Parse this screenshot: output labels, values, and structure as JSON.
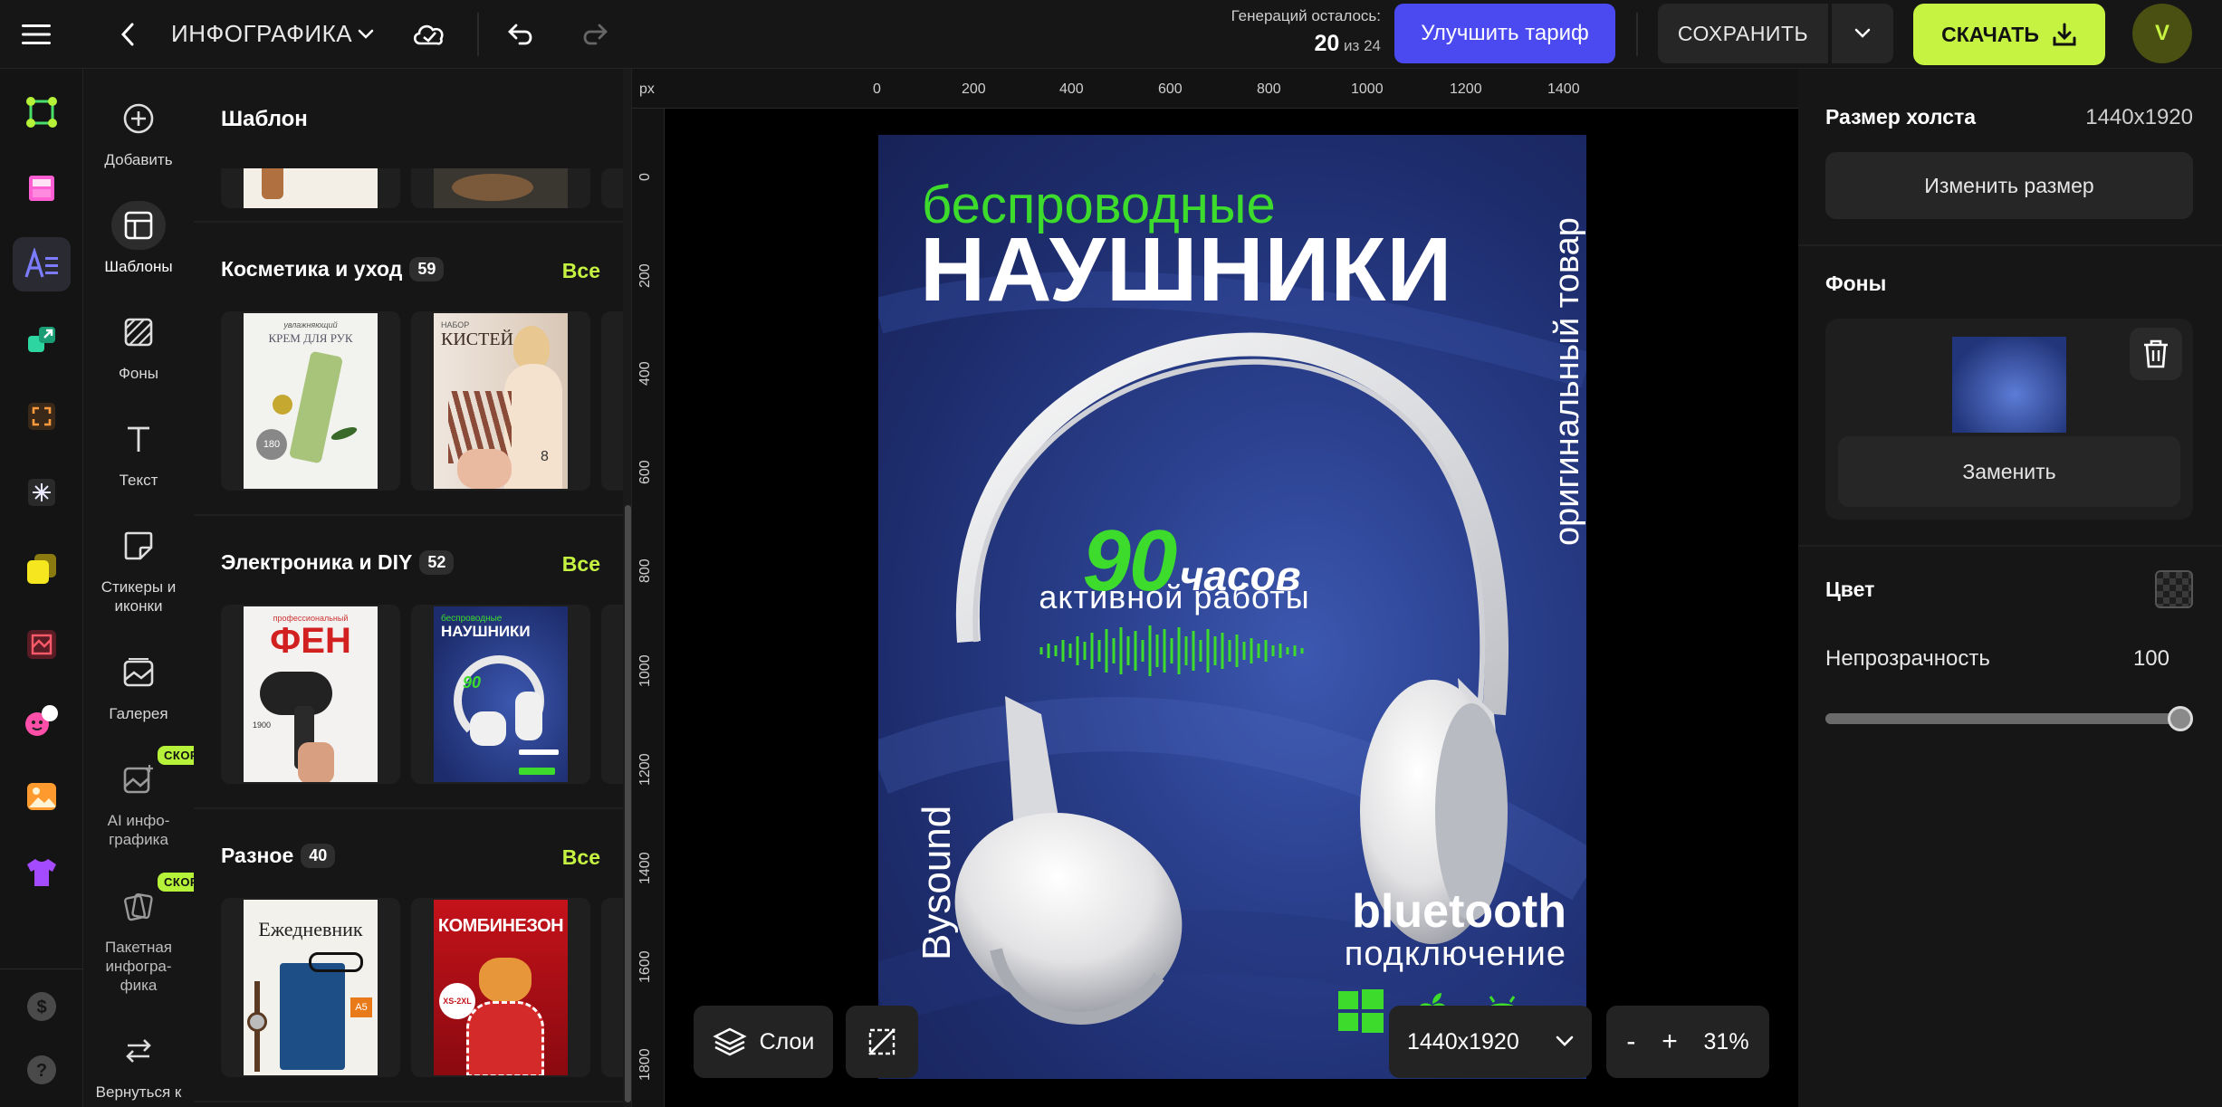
{
  "header": {
    "project_title": "ИНФОГРАФИКА",
    "generations_label": "Генераций осталось:",
    "generations_used": "20",
    "generations_sep": "из",
    "generations_total": "24",
    "upgrade_label": "Улучшить тариф",
    "save_label": "СОХРАНИТЬ",
    "download_label": "СКАЧАТЬ",
    "avatar_letter": "V",
    "accent_color": "#c6f242",
    "upgrade_color": "#4a4af0"
  },
  "rail": {
    "icons": [
      "nodes-icon",
      "layout-icon",
      "text-ai-icon",
      "resize-icon",
      "expand-icon",
      "sparkle-icon",
      "cards-icon",
      "collage-icon",
      "stickers-icon",
      "image-icon",
      "tshirt-icon"
    ],
    "bottom_icons": [
      "dollar-icon",
      "help-icon"
    ]
  },
  "tools": [
    {
      "label": "Добавить"
    },
    {
      "label": "Шаблоны"
    },
    {
      "label": "Фоны"
    },
    {
      "label": "Текст"
    },
    {
      "label": "Стикеры и иконки"
    },
    {
      "label": "Галерея"
    },
    {
      "label": "AI инфо-графика",
      "badge": "СКОРО"
    },
    {
      "label": "Пакетная инфогра-фика",
      "badge": "СКОРО"
    },
    {
      "label": "Вернуться к"
    }
  ],
  "panel": {
    "title": "Шаблон",
    "sections": [
      {
        "title": "Косметика и уход",
        "count": "59",
        "all": "Все",
        "thumbs": [
          {
            "top": "увлажняющий",
            "main": "КРЕМ ДЛЯ РУК",
            "num": "180"
          },
          {
            "top": "НАБОР",
            "main": "КИСТЕЙ",
            "num": "8"
          }
        ]
      },
      {
        "title": "Электроника и DIY",
        "count": "52",
        "all": "Все",
        "thumbs": [
          {
            "top": "профессиональный",
            "main": "ФЕН",
            "num": "1900"
          },
          {
            "top": "беспроводные",
            "main": "НАУШНИКИ",
            "num": "90"
          }
        ]
      },
      {
        "title": "Разное",
        "count": "40",
        "all": "Все",
        "thumbs": [
          {
            "top": "",
            "main": "Ежедневник",
            "num": "A5"
          },
          {
            "top": "",
            "main": "КОМБИНЕЗОН",
            "num": "XS-2XL"
          }
        ]
      }
    ]
  },
  "rulers": {
    "unit": "px",
    "top": [
      "0",
      "200",
      "400",
      "600",
      "800",
      "1000",
      "1200",
      "1400"
    ],
    "left": [
      "0",
      "200",
      "400",
      "600",
      "800",
      "1000",
      "1200",
      "1400",
      "1600",
      "1800"
    ]
  },
  "poster": {
    "line1": "беспроводные",
    "line2": "НАУШНИКИ",
    "side": "оригинальный товар",
    "hours_num": "90",
    "hours_word": "часов",
    "hours_sub": "активной работы",
    "brand": "Bysound",
    "bt_title": "bluetooth",
    "bt_sub": "подключение",
    "green": "#3ddc2c"
  },
  "canvas_controls": {
    "layers_label": "Слои",
    "size_label": "1440x1920",
    "zoom_minus": "-",
    "zoom_plus": "+",
    "zoom_value": "31%"
  },
  "right_panel": {
    "canvas_size_label": "Размер холста",
    "canvas_size_value": "1440x1920",
    "resize_label": "Изменить размер",
    "backgrounds_label": "Фоны",
    "replace_label": "Заменить",
    "color_label": "Цвет",
    "opacity_label": "Непрозрачность",
    "opacity_value": "100",
    "opacity_fraction": 1.0
  }
}
